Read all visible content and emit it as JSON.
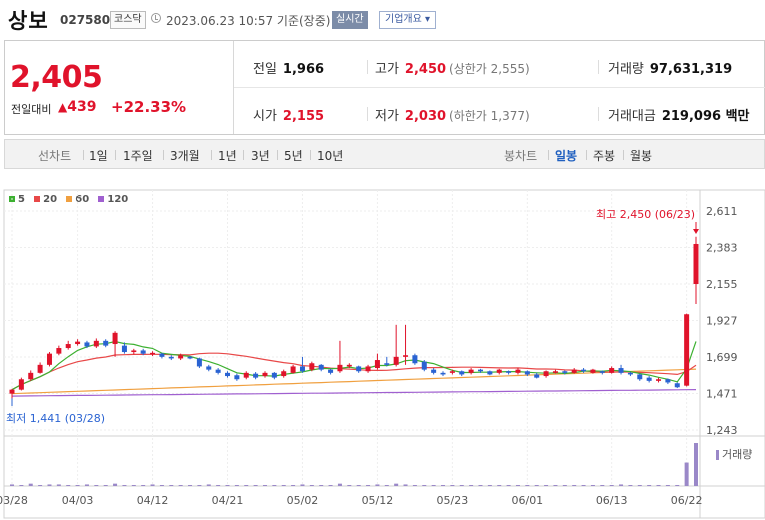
{
  "header": {
    "name": "상보",
    "code": "027580",
    "market": "코스닥",
    "datetime": "2023.06.23 10:57 기준(장중)",
    "realtime_label": "실시간",
    "company_btn": "기업개요 ▾"
  },
  "quote": {
    "price": "2,405",
    "change_label": "전일대비",
    "change_tri": "▲",
    "change_amt": "439",
    "change_pct": "+22.33%",
    "items": {
      "prev_close": {
        "label": "전일",
        "value": "1,966"
      },
      "high": {
        "label": "고가",
        "value": "2,450",
        "sub": "(상한가 2,555)"
      },
      "volume": {
        "label": "거래량",
        "value": "97,631,319"
      },
      "open": {
        "label": "시가",
        "value": "2,155"
      },
      "low": {
        "label": "저가",
        "value": "2,030",
        "sub": "(하한가 1,377)"
      },
      "amount": {
        "label": "거래대금",
        "value": "219,096 백만"
      }
    }
  },
  "period_bar": {
    "line_label": "선차트",
    "line_periods": [
      "1일",
      "1주일",
      "3개월",
      "1년",
      "3년",
      "5년",
      "10년"
    ],
    "candle_label": "봉차트",
    "candle_periods": [
      "일봉",
      "주봉",
      "월봉"
    ],
    "active_candle": "일봉"
  },
  "colors": {
    "up": "#e0132b",
    "down": "#2a63d2",
    "ma5": "#3cb030",
    "ma20": "#e84848",
    "ma60": "#f0a040",
    "ma120": "#a060d0",
    "volume": "#9a88c8"
  },
  "chart_data": {
    "type": "candlestick",
    "legend": [
      {
        "name": "5",
        "color": "#3cb030"
      },
      {
        "name": "20",
        "color": "#e84848"
      },
      {
        "name": "60",
        "color": "#f0a040"
      },
      {
        "name": "120",
        "color": "#a060d0"
      }
    ],
    "y_ticks": [
      "2,611",
      "2,383",
      "2,155",
      "1,927",
      "1,699",
      "1,471",
      "1,243"
    ],
    "ylim": [
      1243,
      2611
    ],
    "x_ticks": [
      "03/28",
      "04/03",
      "04/12",
      "04/21",
      "05/02",
      "05/12",
      "05/23",
      "06/01",
      "06/13",
      "06/22"
    ],
    "high_annotation": "최고 2,450 (06/23)",
    "low_annotation": "최저 1,441 (03/28)",
    "volume_label": "거래량",
    "candles": [
      [
        1470,
        1495,
        1440,
        1500
      ],
      [
        1495,
        1560,
        1490,
        1570
      ],
      [
        1560,
        1600,
        1550,
        1615
      ],
      [
        1600,
        1650,
        1595,
        1665
      ],
      [
        1650,
        1720,
        1640,
        1730
      ],
      [
        1720,
        1755,
        1710,
        1770
      ],
      [
        1755,
        1780,
        1745,
        1800
      ],
      [
        1780,
        1795,
        1770,
        1810
      ],
      [
        1790,
        1765,
        1755,
        1800
      ],
      [
        1765,
        1800,
        1755,
        1815
      ],
      [
        1800,
        1770,
        1760,
        1810
      ],
      [
        1780,
        1850,
        1700,
        1860
      ],
      [
        1770,
        1730,
        1720,
        1790
      ],
      [
        1730,
        1740,
        1715,
        1750
      ],
      [
        1740,
        1720,
        1710,
        1750
      ],
      [
        1720,
        1725,
        1705,
        1735
      ],
      [
        1720,
        1700,
        1690,
        1725
      ],
      [
        1700,
        1690,
        1680,
        1710
      ],
      [
        1690,
        1710,
        1680,
        1720
      ],
      [
        1700,
        1690,
        1685,
        1705
      ],
      [
        1690,
        1640,
        1630,
        1695
      ],
      [
        1640,
        1620,
        1610,
        1650
      ],
      [
        1620,
        1600,
        1590,
        1630
      ],
      [
        1600,
        1580,
        1570,
        1610
      ],
      [
        1585,
        1560,
        1550,
        1595
      ],
      [
        1570,
        1600,
        1560,
        1610
      ],
      [
        1595,
        1570,
        1560,
        1605
      ],
      [
        1580,
        1600,
        1570,
        1610
      ],
      [
        1600,
        1570,
        1560,
        1605
      ],
      [
        1580,
        1610,
        1570,
        1620
      ],
      [
        1600,
        1640,
        1595,
        1650
      ],
      [
        1640,
        1610,
        1600,
        1700
      ],
      [
        1620,
        1660,
        1610,
        1670
      ],
      [
        1650,
        1620,
        1610,
        1655
      ],
      [
        1620,
        1600,
        1590,
        1625
      ],
      [
        1610,
        1650,
        1600,
        1800
      ],
      [
        1640,
        1650,
        1630,
        1660
      ],
      [
        1640,
        1610,
        1600,
        1645
      ],
      [
        1610,
        1640,
        1600,
        1650
      ],
      [
        1630,
        1680,
        1620,
        1720
      ],
      [
        1660,
        1650,
        1640,
        1700
      ],
      [
        1650,
        1700,
        1640,
        1900
      ],
      [
        1700,
        1710,
        1650,
        1900
      ],
      [
        1710,
        1660,
        1650,
        1720
      ],
      [
        1670,
        1620,
        1610,
        1680
      ],
      [
        1620,
        1600,
        1590,
        1630
      ],
      [
        1600,
        1590,
        1580,
        1610
      ],
      [
        1600,
        1610,
        1590,
        1620
      ],
      [
        1610,
        1590,
        1580,
        1615
      ],
      [
        1600,
        1620,
        1590,
        1630
      ],
      [
        1620,
        1610,
        1600,
        1625
      ],
      [
        1610,
        1590,
        1585,
        1615
      ],
      [
        1600,
        1620,
        1590,
        1625
      ],
      [
        1610,
        1600,
        1590,
        1615
      ],
      [
        1600,
        1620,
        1590,
        1630
      ],
      [
        1610,
        1590,
        1580,
        1615
      ],
      [
        1590,
        1570,
        1565,
        1600
      ],
      [
        1580,
        1610,
        1570,
        1615
      ],
      [
        1600,
        1610,
        1595,
        1620
      ],
      [
        1610,
        1600,
        1590,
        1615
      ],
      [
        1600,
        1620,
        1595,
        1630
      ],
      [
        1620,
        1610,
        1600,
        1630
      ],
      [
        1600,
        1620,
        1595,
        1625
      ],
      [
        1610,
        1600,
        1590,
        1615
      ],
      [
        1600,
        1630,
        1595,
        1640
      ],
      [
        1630,
        1600,
        1590,
        1650
      ],
      [
        1600,
        1590,
        1580,
        1605
      ],
      [
        1590,
        1560,
        1550,
        1595
      ],
      [
        1570,
        1550,
        1540,
        1580
      ],
      [
        1550,
        1560,
        1540,
        1570
      ],
      [
        1560,
        1540,
        1530,
        1565
      ],
      [
        1535,
        1510,
        1505,
        1540
      ],
      [
        1520,
        1966,
        1515,
        1970
      ],
      [
        2155,
        2405,
        2030,
        2450
      ]
    ],
    "volume": [
      2,
      1,
      3,
      1,
      2,
      2,
      1,
      1,
      2,
      1,
      1,
      3,
      1,
      1,
      1,
      2,
      1,
      1,
      1,
      1,
      1,
      2,
      1,
      1,
      1,
      1,
      1,
      1,
      1,
      1,
      1,
      2,
      1,
      1,
      1,
      3,
      1,
      1,
      1,
      2,
      1,
      3,
      2,
      1,
      1,
      1,
      1,
      1,
      1,
      1,
      1,
      1,
      1,
      1,
      1,
      1,
      1,
      1,
      1,
      1,
      1,
      1,
      1,
      1,
      1,
      2,
      1,
      1,
      1,
      1,
      1,
      1,
      30,
      55
    ]
  }
}
